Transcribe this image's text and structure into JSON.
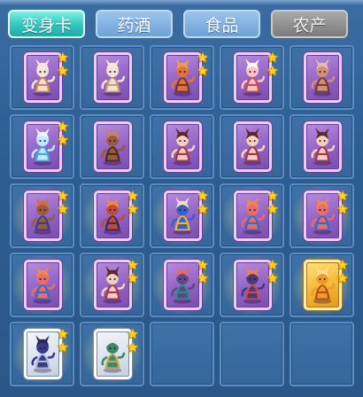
{
  "tabs": [
    {
      "label": "变身卡",
      "state": "active"
    },
    {
      "label": "药酒",
      "state": "normal"
    },
    {
      "label": "食品",
      "state": "normal"
    },
    {
      "label": "农产",
      "state": "disabled"
    }
  ],
  "colors": {
    "star": "#ffd21f",
    "star_outline": "#c98a00"
  },
  "slots": [
    {
      "character": "white-rabbit-character",
      "stars": 2,
      "frame": "purple",
      "glow": false,
      "figure": {
        "body": "#f3e4d6",
        "accent": "#c78a5a",
        "hair": "#f6e8d8"
      }
    },
    {
      "character": "white-rabbit-character",
      "stars": 0,
      "frame": "purple",
      "glow": false,
      "figure": {
        "body": "#f1e3d5",
        "accent": "#c9a06a",
        "hair": "#f6e8d8"
      }
    },
    {
      "character": "fox-warrior-character",
      "stars": 2,
      "frame": "purple",
      "glow": false,
      "figure": {
        "body": "#e0743b",
        "accent": "#7a3620",
        "hair": "#f39a48"
      }
    },
    {
      "character": "pig-character",
      "stars": 2,
      "frame": "purple",
      "glow": false,
      "figure": {
        "body": "#f7c3c3",
        "accent": "#c94a4a",
        "hair": "#ffffff"
      }
    },
    {
      "character": "boar-character",
      "stars": 0,
      "frame": "purple",
      "glow": false,
      "figure": {
        "body": "#cf8f7b",
        "accent": "#7a3a2c",
        "hair": "#e7b9a8"
      }
    },
    {
      "character": "ice-fairy-character",
      "stars": 2,
      "frame": "purple",
      "glow": false,
      "figure": {
        "body": "#bfe8ff",
        "accent": "#4aa4e0",
        "hair": "#eaf7ff"
      }
    },
    {
      "character": "brown-beast-character",
      "stars": 0,
      "frame": "purple",
      "glow": false,
      "figure": {
        "body": "#9a5a3c",
        "accent": "#4d2a1c",
        "hair": "#c9845a"
      }
    },
    {
      "character": "dancer-character",
      "stars": 0,
      "frame": "purple",
      "glow": false,
      "figure": {
        "body": "#f3d0c0",
        "accent": "#a8344a",
        "hair": "#5a2a22"
      }
    },
    {
      "character": "dancer-character",
      "stars": 0,
      "frame": "purple",
      "glow": false,
      "figure": {
        "body": "#f3d0c0",
        "accent": "#a8344a",
        "hair": "#5a2a22"
      }
    },
    {
      "character": "dancer-character",
      "stars": 0,
      "frame": "purple",
      "glow": false,
      "figure": {
        "body": "#f3d0c0",
        "accent": "#a8344a",
        "hair": "#5a2a22"
      }
    },
    {
      "character": "bandit-character",
      "stars": 2,
      "frame": "purple",
      "glow": true,
      "figure": {
        "body": "#9a5a3c",
        "accent": "#3d3f7a",
        "hair": "#d86b3a"
      }
    },
    {
      "character": "red-warrior-character",
      "stars": 2,
      "frame": "purple",
      "glow": true,
      "figure": {
        "body": "#c44a36",
        "accent": "#3a2a5a",
        "hair": "#ed8a4a"
      }
    },
    {
      "character": "blue-general-character",
      "stars": 2,
      "frame": "purple",
      "glow": true,
      "figure": {
        "body": "#3a5fc4",
        "accent": "#e6b83a",
        "hair": "#f2e0c0"
      }
    },
    {
      "character": "pink-fighter-character",
      "stars": 2,
      "frame": "purple",
      "glow": true,
      "figure": {
        "body": "#e86c6c",
        "accent": "#3a6ab8",
        "hair": "#f08a4a"
      }
    },
    {
      "character": "pink-fighter-character",
      "stars": 2,
      "frame": "purple",
      "glow": true,
      "figure": {
        "body": "#e86c6c",
        "accent": "#3a6ab8",
        "hair": "#f08a4a"
      }
    },
    {
      "character": "pink-fighter-character",
      "stars": 0,
      "frame": "purple",
      "glow": true,
      "figure": {
        "body": "#e86c6c",
        "accent": "#3a6ab8",
        "hair": "#f08a4a"
      }
    },
    {
      "character": "dancer-character",
      "stars": 2,
      "frame": "purple",
      "glow": true,
      "figure": {
        "body": "#f3d0c0",
        "accent": "#a8344a",
        "hair": "#5a2a22"
      }
    },
    {
      "character": "armored-knight-character",
      "stars": 2,
      "frame": "purple",
      "glow": true,
      "figure": {
        "body": "#5a4a8a",
        "accent": "#2e8a8a",
        "hair": "#e86a5a"
      }
    },
    {
      "character": "armored-knight-character",
      "stars": 2,
      "frame": "purple",
      "glow": true,
      "figure": {
        "body": "#4a3a7a",
        "accent": "#d04a4a",
        "hair": "#ee8050"
      }
    },
    {
      "character": "golden-dragon-character",
      "stars": 2,
      "frame": "gold",
      "glow": true,
      "figure": {
        "body": "#f09a2a",
        "accent": "#b0501a",
        "hair": "#ffe08a"
      }
    },
    {
      "character": "purple-swordsman-character",
      "stars": 2,
      "frame": "white",
      "glow": true,
      "figure": {
        "body": "#3a3a8a",
        "accent": "#b0b8d8",
        "hair": "#2a2a5a"
      }
    },
    {
      "character": "green-sage-character",
      "stars": 2,
      "frame": "white",
      "glow": true,
      "figure": {
        "body": "#3a8a6a",
        "accent": "#c9a85a",
        "hair": "#e8e8e8"
      }
    },
    {
      "character": "",
      "stars": 0,
      "frame": "",
      "glow": false,
      "figure": null
    },
    {
      "character": "",
      "stars": 0,
      "frame": "",
      "glow": false,
      "figure": null
    },
    {
      "character": "",
      "stars": 0,
      "frame": "",
      "glow": false,
      "figure": null
    }
  ]
}
